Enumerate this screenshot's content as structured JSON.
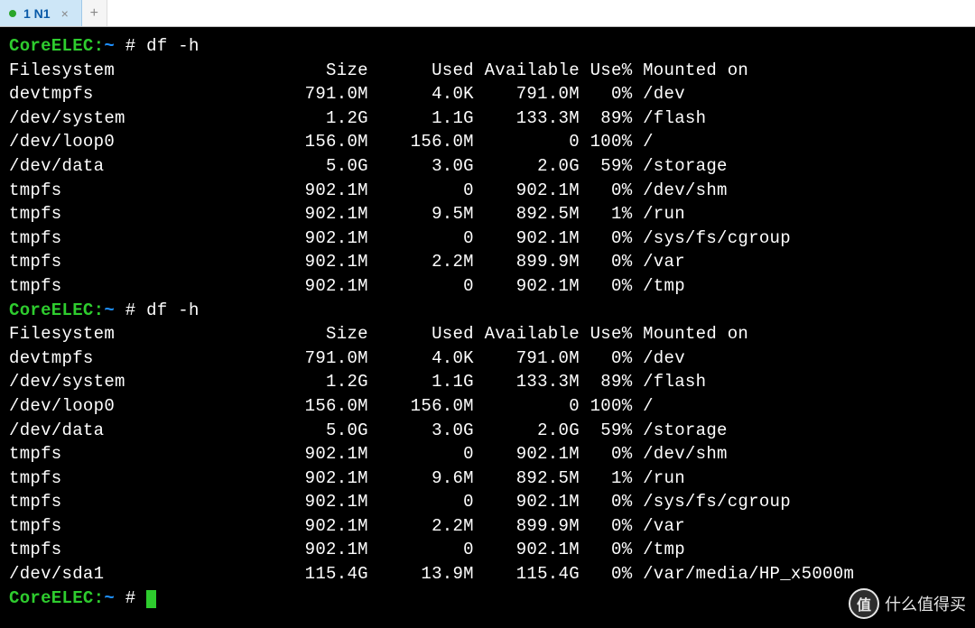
{
  "tab": {
    "label": "1 N1",
    "close": "×",
    "add": "+"
  },
  "prompt": {
    "host": "CoreELEC:",
    "tilde": "~",
    "hash": "#"
  },
  "command": "df -h",
  "header": {
    "fs": "Filesystem",
    "size": "Size",
    "used": "Used",
    "avail": "Available",
    "usep": "Use%",
    "mount": "Mounted on"
  },
  "block1": [
    {
      "fs": "devtmpfs",
      "size": "791.0M",
      "used": "4.0K",
      "avail": "791.0M",
      "usep": "0%",
      "mount": "/dev"
    },
    {
      "fs": "/dev/system",
      "size": "1.2G",
      "used": "1.1G",
      "avail": "133.3M",
      "usep": "89%",
      "mount": "/flash"
    },
    {
      "fs": "/dev/loop0",
      "size": "156.0M",
      "used": "156.0M",
      "avail": "0",
      "usep": "100%",
      "mount": "/"
    },
    {
      "fs": "/dev/data",
      "size": "5.0G",
      "used": "3.0G",
      "avail": "2.0G",
      "usep": "59%",
      "mount": "/storage"
    },
    {
      "fs": "tmpfs",
      "size": "902.1M",
      "used": "0",
      "avail": "902.1M",
      "usep": "0%",
      "mount": "/dev/shm"
    },
    {
      "fs": "tmpfs",
      "size": "902.1M",
      "used": "9.5M",
      "avail": "892.5M",
      "usep": "1%",
      "mount": "/run"
    },
    {
      "fs": "tmpfs",
      "size": "902.1M",
      "used": "0",
      "avail": "902.1M",
      "usep": "0%",
      "mount": "/sys/fs/cgroup"
    },
    {
      "fs": "tmpfs",
      "size": "902.1M",
      "used": "2.2M",
      "avail": "899.9M",
      "usep": "0%",
      "mount": "/var"
    },
    {
      "fs": "tmpfs",
      "size": "902.1M",
      "used": "0",
      "avail": "902.1M",
      "usep": "0%",
      "mount": "/tmp"
    }
  ],
  "block2": [
    {
      "fs": "devtmpfs",
      "size": "791.0M",
      "used": "4.0K",
      "avail": "791.0M",
      "usep": "0%",
      "mount": "/dev"
    },
    {
      "fs": "/dev/system",
      "size": "1.2G",
      "used": "1.1G",
      "avail": "133.3M",
      "usep": "89%",
      "mount": "/flash"
    },
    {
      "fs": "/dev/loop0",
      "size": "156.0M",
      "used": "156.0M",
      "avail": "0",
      "usep": "100%",
      "mount": "/"
    },
    {
      "fs": "/dev/data",
      "size": "5.0G",
      "used": "3.0G",
      "avail": "2.0G",
      "usep": "59%",
      "mount": "/storage"
    },
    {
      "fs": "tmpfs",
      "size": "902.1M",
      "used": "0",
      "avail": "902.1M",
      "usep": "0%",
      "mount": "/dev/shm"
    },
    {
      "fs": "tmpfs",
      "size": "902.1M",
      "used": "9.6M",
      "avail": "892.5M",
      "usep": "1%",
      "mount": "/run"
    },
    {
      "fs": "tmpfs",
      "size": "902.1M",
      "used": "0",
      "avail": "902.1M",
      "usep": "0%",
      "mount": "/sys/fs/cgroup"
    },
    {
      "fs": "tmpfs",
      "size": "902.1M",
      "used": "2.2M",
      "avail": "899.9M",
      "usep": "0%",
      "mount": "/var"
    },
    {
      "fs": "tmpfs",
      "size": "902.1M",
      "used": "0",
      "avail": "902.1M",
      "usep": "0%",
      "mount": "/tmp"
    },
    {
      "fs": "/dev/sda1",
      "size": "115.4G",
      "used": "13.9M",
      "avail": "115.4G",
      "usep": "0%",
      "mount": "/var/media/HP_x5000m"
    }
  ],
  "watermark": {
    "badge": "值",
    "text": "什么值得买"
  },
  "cols": {
    "fs": 24,
    "size": 10,
    "used": 10,
    "avail": 10,
    "usep": 5
  }
}
